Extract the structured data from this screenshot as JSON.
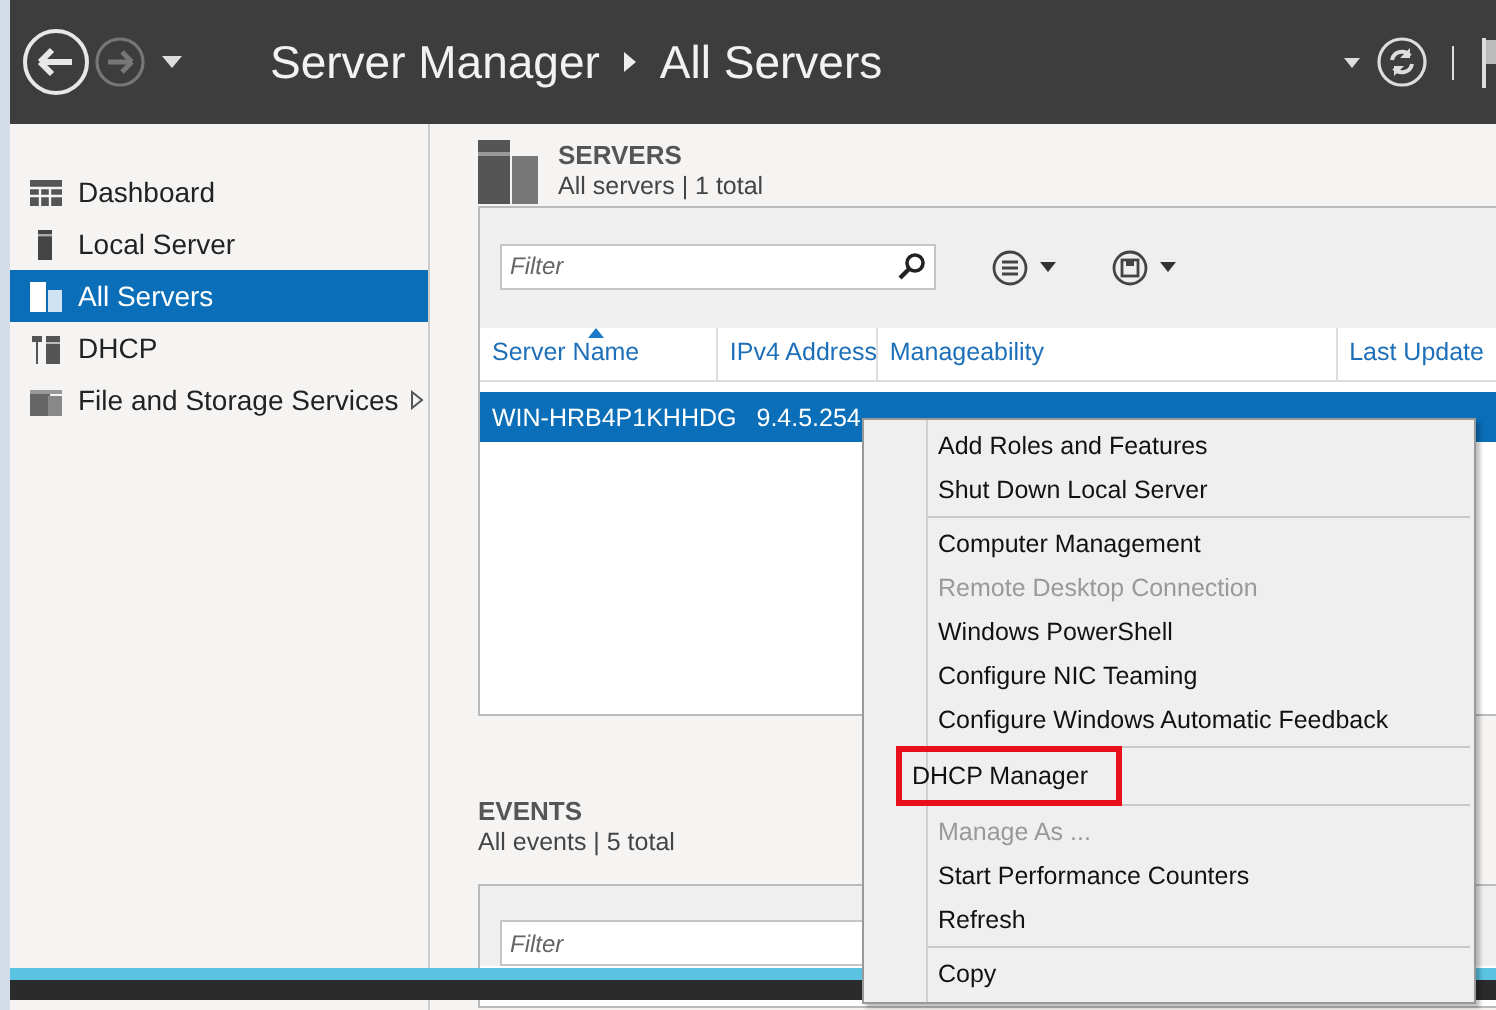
{
  "window": {
    "title": "Server Manager",
    "breadcrumb": "All Servers"
  },
  "sidebar": {
    "items": [
      {
        "label": "Dashboard",
        "kind": "dashboard",
        "selected": false,
        "has_submenu": false
      },
      {
        "label": "Local Server",
        "kind": "server",
        "selected": false,
        "has_submenu": false
      },
      {
        "label": "All Servers",
        "kind": "servers",
        "selected": true,
        "has_submenu": false
      },
      {
        "label": "DHCP",
        "kind": "tools",
        "selected": false,
        "has_submenu": false
      },
      {
        "label": "File and Storage Services",
        "kind": "storage",
        "selected": false,
        "has_submenu": true
      }
    ]
  },
  "servers": {
    "title": "SERVERS",
    "subtitle": "All servers | 1 total",
    "filter": {
      "placeholder": "Filter"
    },
    "columns": [
      {
        "label": "Server Name",
        "sorted": true
      },
      {
        "label": "IPv4 Address",
        "sorted": false
      },
      {
        "label": "Manageability",
        "sorted": false
      },
      {
        "label": "Last Update",
        "sorted": false
      }
    ],
    "rows": [
      {
        "cells": [
          "WIN-HRB4P1KHHDG",
          "9.4.5.254"
        ],
        "selected": true
      }
    ]
  },
  "events": {
    "title": "EVENTS",
    "subtitle": "All events | 5 total",
    "filter": {
      "placeholder": "Filter"
    }
  },
  "context_menu": {
    "groups": [
      [
        {
          "label": "Add Roles and Features",
          "disabled": false,
          "highlighted": false
        },
        {
          "label": "Shut Down Local Server",
          "disabled": false,
          "highlighted": false
        }
      ],
      [
        {
          "label": "Computer Management",
          "disabled": false,
          "highlighted": false
        },
        {
          "label": "Remote Desktop Connection",
          "disabled": true,
          "highlighted": false
        },
        {
          "label": "Windows PowerShell",
          "disabled": false,
          "highlighted": false
        },
        {
          "label": "Configure NIC Teaming",
          "disabled": false,
          "highlighted": false
        },
        {
          "label": "Configure Windows Automatic Feedback",
          "disabled": false,
          "highlighted": false
        }
      ],
      [
        {
          "label": "DHCP Manager",
          "disabled": false,
          "highlighted": true
        }
      ],
      [
        {
          "label": "Manage As ...",
          "disabled": true,
          "highlighted": false
        },
        {
          "label": "Start Performance Counters",
          "disabled": false,
          "highlighted": false
        },
        {
          "label": "Refresh",
          "disabled": false,
          "highlighted": false
        }
      ],
      [
        {
          "label": "Copy",
          "disabled": false,
          "highlighted": false
        }
      ]
    ]
  }
}
